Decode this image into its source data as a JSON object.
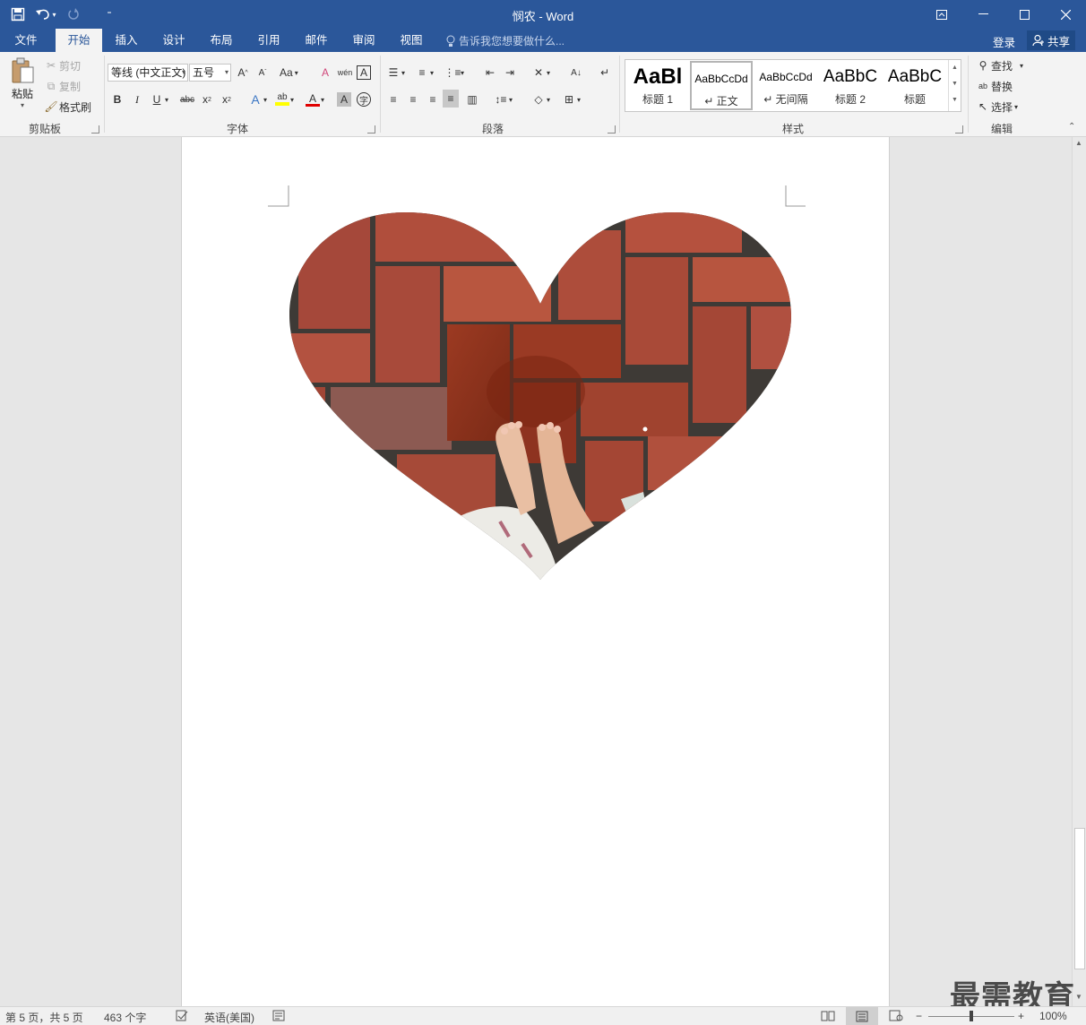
{
  "titlebar": {
    "doc_title": "悯农 - Word",
    "qat": {
      "save_icon": "save-icon",
      "undo_icon": "undo-icon",
      "redo_icon": "redo-icon",
      "customize_icon": "customize-qat-icon"
    }
  },
  "tabs": [
    "文件",
    "开始",
    "插入",
    "设计",
    "布局",
    "引用",
    "邮件",
    "审阅",
    "视图"
  ],
  "active_tab": "开始",
  "tell_me": "告诉我您想要做什么...",
  "account": {
    "login": "登录",
    "share": "共享"
  },
  "clipboard": {
    "paste": "粘贴",
    "cut": "剪切",
    "copy": "复制",
    "format_painter": "格式刷",
    "label": "剪贴板"
  },
  "font": {
    "name": "等线 (中文正文)",
    "size": "五号",
    "label": "字体",
    "change_case": "Aa"
  },
  "paragraph": {
    "label": "段落"
  },
  "styles": {
    "label": "样式",
    "items": [
      {
        "sample": "AaBl",
        "name": "标题 1"
      },
      {
        "sample": "AaBbCcDd",
        "name": "↵ 正文"
      },
      {
        "sample": "AaBbCcDd",
        "name": "↵ 无间隔"
      },
      {
        "sample": "AaBbC",
        "name": "标题 2"
      },
      {
        "sample": "AaBbC",
        "name": "标题"
      }
    ]
  },
  "editing": {
    "find": "查找",
    "replace": "替换",
    "select": "选择",
    "label": "编辑"
  },
  "status": {
    "page": "第 5 页，共 5 页",
    "words": "463 个字",
    "language": "英语(美国)",
    "zoom": "100%"
  },
  "zoom_level": 1.0,
  "watermark": "最需教育",
  "colors": {
    "accent": "#2b579a",
    "highlight": "#ffff00",
    "font_color": "#e00000"
  }
}
